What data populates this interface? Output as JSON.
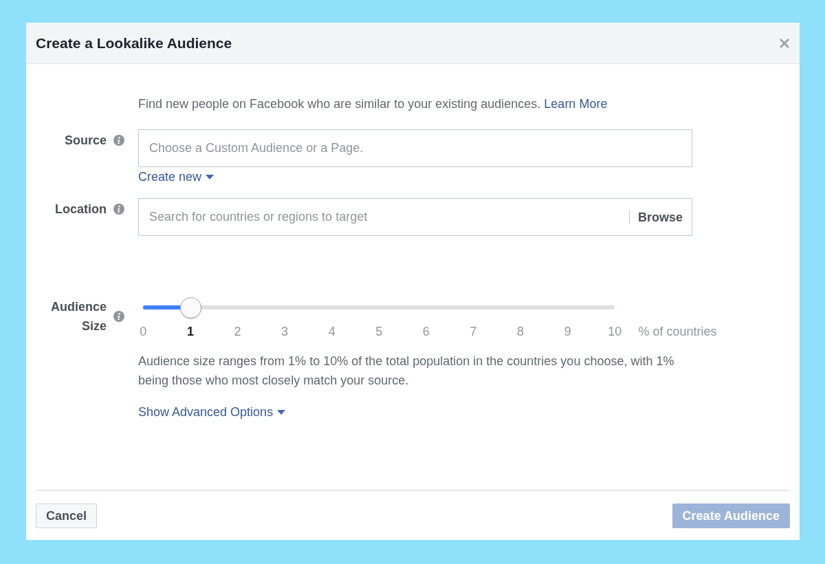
{
  "dialog": {
    "title": "Create a Lookalike Audience",
    "intro": {
      "text": "Find new people on Facebook who are similar to your existing audiences.",
      "link": "Learn More"
    },
    "source": {
      "label": "Source",
      "placeholder": "Choose a Custom Audience or a Page.",
      "create_link": "Create new"
    },
    "location": {
      "label": "Location",
      "placeholder": "Search for countries or regions to target",
      "browse": "Browse"
    },
    "audience_size": {
      "label": "Audience Size",
      "level": 0.1,
      "ticks": [
        {
          "label": "0",
          "selected": false
        },
        {
          "label": "1",
          "selected": true
        },
        {
          "label": "2",
          "selected": false
        },
        {
          "label": "3",
          "selected": false
        },
        {
          "label": "4",
          "selected": false
        },
        {
          "label": "5",
          "selected": false
        },
        {
          "label": "6",
          "selected": false
        },
        {
          "label": "7",
          "selected": false
        },
        {
          "label": "8",
          "selected": false
        },
        {
          "label": "9",
          "selected": false
        },
        {
          "label": "10",
          "selected": false
        }
      ],
      "unit": "% of countries",
      "description": "Audience size ranges from 1% to 10% of the total population in the countries you choose, with 1% being those who most closely match your source.",
      "advanced_link": "Show Advanced Options"
    },
    "footer": {
      "cancel": "Cancel",
      "create": {
        "label": "Create Audience",
        "disabled": true
      }
    }
  }
}
